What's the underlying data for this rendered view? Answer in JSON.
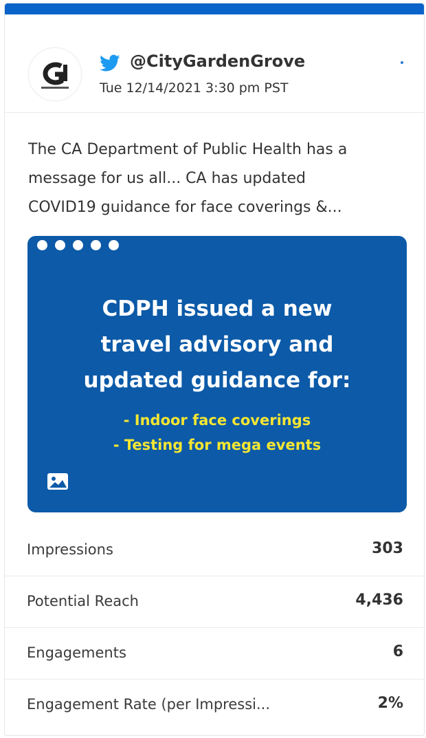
{
  "colors": {
    "topbar": "#0a63c9",
    "media_bg": "#0c5aa8",
    "bullet_text": "#f5e633",
    "twitter_blue": "#1d9bf0",
    "menu_dot": "#2a7bd4"
  },
  "post": {
    "handle": "@CityGardenGrove",
    "timestamp": "Tue 12/14/2021 3:30 pm PST",
    "network_icon": "twitter-bird-icon",
    "avatar_logo": "city-of-garden-grove-logo",
    "text_lines": [
      "The CA Department of Public Health has a",
      "message for us all... CA has updated",
      "COVID19 guidance for face coverings &..."
    ]
  },
  "media": {
    "headline_lines": [
      "CDPH issued a new",
      "travel advisory and",
      "updated guidance for:"
    ],
    "bullets": [
      "- Indoor face coverings",
      "- Testing for mega events"
    ],
    "media_type_icon": "image-icon"
  },
  "stats": [
    {
      "label": "Impressions",
      "value": "303"
    },
    {
      "label": "Potential Reach",
      "value": "4,436"
    },
    {
      "label": "Engagements",
      "value": "6"
    },
    {
      "label": "Engagement Rate (per Impressi...",
      "value": "2%"
    }
  ]
}
